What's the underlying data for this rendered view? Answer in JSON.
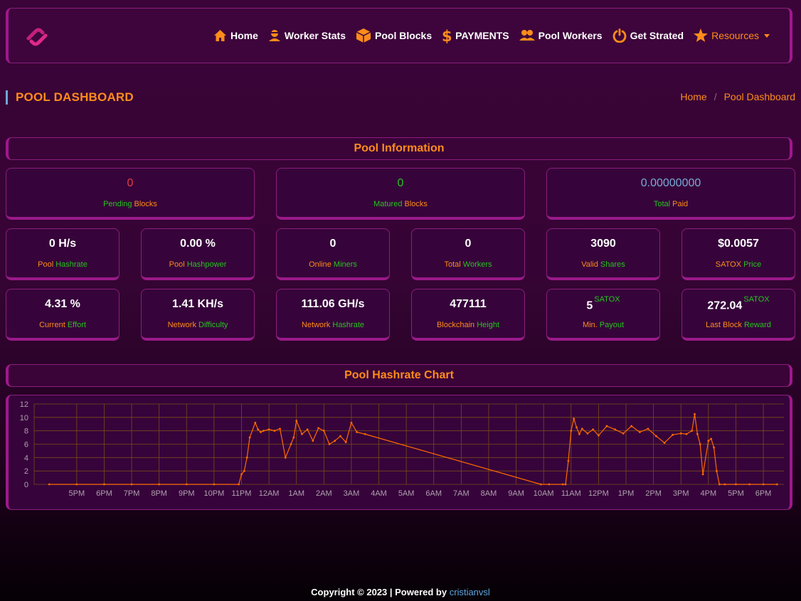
{
  "nav": {
    "items": [
      {
        "label": "Home",
        "icon": "home-icon"
      },
      {
        "label": "Worker Stats",
        "icon": "user-icon"
      },
      {
        "label": "Pool Blocks",
        "icon": "cube-icon"
      },
      {
        "label": "PAYMENTS",
        "icon": "dollar-icon"
      },
      {
        "label": "Pool Workers",
        "icon": "users-icon"
      },
      {
        "label": "Get Strated",
        "icon": "power-icon"
      },
      {
        "label": "Resources",
        "icon": "star-icon"
      }
    ]
  },
  "page_title": "POOL DASHBOARD",
  "breadcrumb": {
    "home": "Home",
    "sep": "/",
    "current": "Pool Dashboard"
  },
  "sections": {
    "info": "Pool Information",
    "chart": "Pool Hashrate Chart"
  },
  "top_cards": [
    {
      "value": "0",
      "label_a": "Pending",
      "label_b": "Blocks",
      "value_color": "#e8394a"
    },
    {
      "value": "0",
      "label_a": "Matured",
      "label_b": "Blocks",
      "value_color": "#27c41f"
    },
    {
      "value": "0.00000000",
      "label_a": "Total",
      "label_b": "Paid",
      "value_color": "#7aaad8"
    }
  ],
  "row2": [
    {
      "value": "0 H/s",
      "label_a": "Pool",
      "label_b": "Hashrate"
    },
    {
      "value": "0.00 %",
      "label_a": "Pool",
      "label_b": "Hashpower"
    },
    {
      "value": "0",
      "label_a": "Online",
      "label_b": "Miners"
    },
    {
      "value": "0",
      "label_a": "Total",
      "label_b": "Workers"
    },
    {
      "value": "3090",
      "label_a": "Valid",
      "label_b": "Shares"
    },
    {
      "value": "$0.0057",
      "label_a": "SATOX",
      "label_b": "Price"
    }
  ],
  "row3": [
    {
      "value": "4.31 %",
      "label_a": "Current",
      "label_b": "Effort"
    },
    {
      "value": "1.41 KH/s",
      "label_a": "Network",
      "label_b": "Difficulty"
    },
    {
      "value": "111.06 GH/s",
      "label_a": "Network",
      "label_b": "Hashrate"
    },
    {
      "value": "477111",
      "label_a": "Blockchain",
      "label_b": "Height"
    },
    {
      "value": "5",
      "sup": "SATOX",
      "label_a": "Min.",
      "label_b": "Payout"
    },
    {
      "value": "272.04",
      "sup": "SATOX",
      "label_a": "Last Block",
      "label_b": "Reward"
    }
  ],
  "colors": {
    "accent": "#ff8c1a",
    "green": "#27c41f",
    "magenta": "#a0188e",
    "line": "#ff6a00"
  },
  "chart_data": {
    "type": "line",
    "title": "",
    "xlabel": "",
    "ylabel": "",
    "ylim": [
      0,
      12
    ],
    "yticks": [
      0,
      2,
      4,
      6,
      8,
      10,
      12
    ],
    "xticks": [
      "5PM",
      "6PM",
      "7PM",
      "8PM",
      "9PM",
      "10PM",
      "11PM",
      "12AM",
      "1AM",
      "2AM",
      "3AM",
      "4AM",
      "5AM",
      "6AM",
      "7AM",
      "8AM",
      "9AM",
      "10AM",
      "11AM",
      "12PM",
      "1PM",
      "2PM",
      "3PM",
      "4PM",
      "5PM",
      "6PM"
    ],
    "x_start_hours_before_5PM": 1,
    "series": [
      {
        "name": "",
        "x": [
          -1,
          0,
          1,
          2,
          3,
          4,
          5,
          5.9,
          6,
          6.1,
          6.2,
          6.3,
          6.5,
          6.6,
          6.7,
          6.8,
          7,
          7.2,
          7.4,
          7.6,
          7.8,
          7.9,
          8,
          8.2,
          8.4,
          8.6,
          8.8,
          9,
          9.2,
          9.4,
          9.6,
          9.8,
          10,
          10.2,
          10.5,
          16.9,
          17.2,
          17.7,
          17.8,
          17.9,
          18,
          18.1,
          18.2,
          18.3,
          18.4,
          18.6,
          18.8,
          19,
          19.3,
          19.6,
          19.9,
          20.2,
          20.5,
          20.8,
          21.1,
          21.4,
          21.7,
          22,
          22.2,
          22.4,
          22.5,
          22.6,
          22.7,
          22.8,
          23,
          23.1,
          23.2,
          23.3,
          23.4,
          23.6,
          24,
          24.5,
          25,
          25.5
        ],
        "y": [
          0,
          0,
          0,
          0,
          0,
          0,
          0,
          0,
          1.5,
          2,
          4,
          7,
          9.2,
          8.2,
          7.8,
          8,
          8.2,
          8,
          8.3,
          4,
          6,
          7,
          9.5,
          7.5,
          8.2,
          6.5,
          8.4,
          8,
          6,
          6.5,
          7.2,
          6.3,
          9.2,
          7.8,
          7.5,
          0,
          0,
          0,
          0,
          3.5,
          8,
          9.8,
          8.5,
          7.5,
          8.3,
          7.6,
          8.2,
          7.3,
          8.7,
          8.2,
          7.6,
          8.7,
          7.8,
          8.3,
          7.2,
          6.2,
          7.4,
          7.6,
          7.5,
          8.0,
          10.5,
          7.5,
          6,
          1.5,
          6.5,
          6.8,
          5.5,
          2,
          0,
          0,
          0,
          0,
          0,
          0
        ]
      }
    ],
    "grid": true
  },
  "footer": {
    "text": "Copyright © 2023 | Powered by",
    "link": "cristianvsl"
  }
}
